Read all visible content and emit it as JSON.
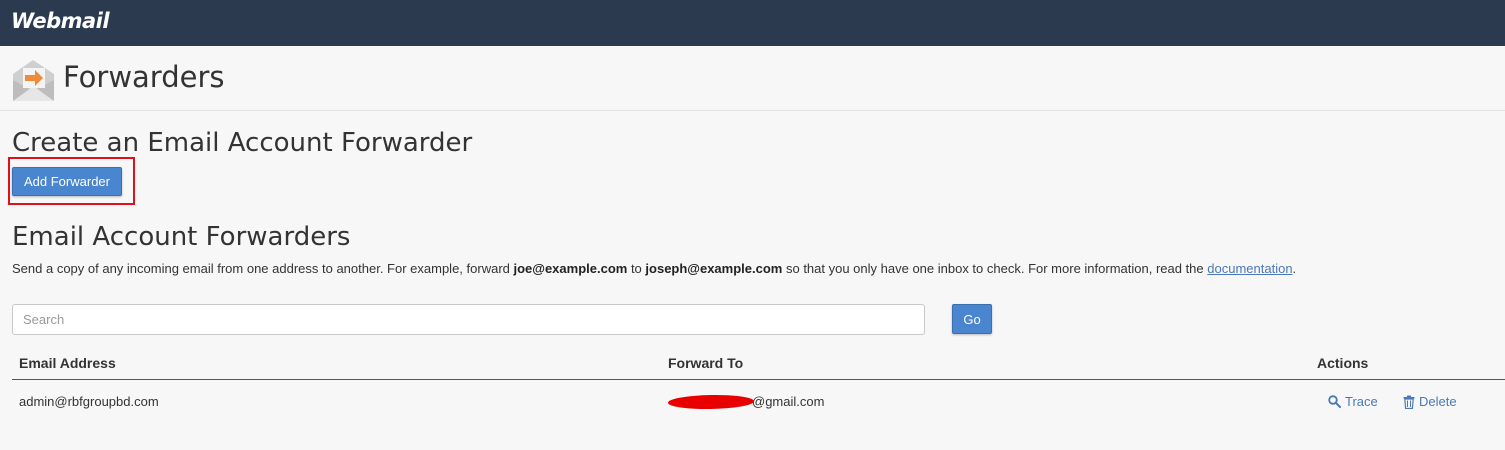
{
  "app": {
    "logo": "Webmail"
  },
  "page": {
    "title": "Forwarders",
    "icon": "email-forward-icon"
  },
  "create_section": {
    "title": "Create an Email Account Forwarder",
    "add_button_label": "Add Forwarder"
  },
  "list_section": {
    "title": "Email Account Forwarders",
    "description": {
      "part1": "Send a copy of any incoming email from one address to another. For example, forward ",
      "example_from": "joe@example.com",
      "part2": " to ",
      "example_to": "joseph@example.com",
      "part3": " so that you only have one inbox to check. For more information, read the ",
      "link_text": "documentation",
      "part4": "."
    }
  },
  "search": {
    "placeholder": "Search",
    "go_label": "Go"
  },
  "table": {
    "columns": {
      "email": "Email Address",
      "forward_to": "Forward To",
      "actions": "Actions"
    },
    "rows": [
      {
        "email": "admin@rbfgroupbd.com",
        "forward_to_visible": "@gmail.com",
        "trace_label": "Trace",
        "delete_label": "Delete"
      }
    ]
  },
  "colors": {
    "topbar": "#2b3a4e",
    "accent": "#4a86cf",
    "link": "#4a78b8",
    "highlight": "#e0101a",
    "redaction": "#e80000"
  }
}
